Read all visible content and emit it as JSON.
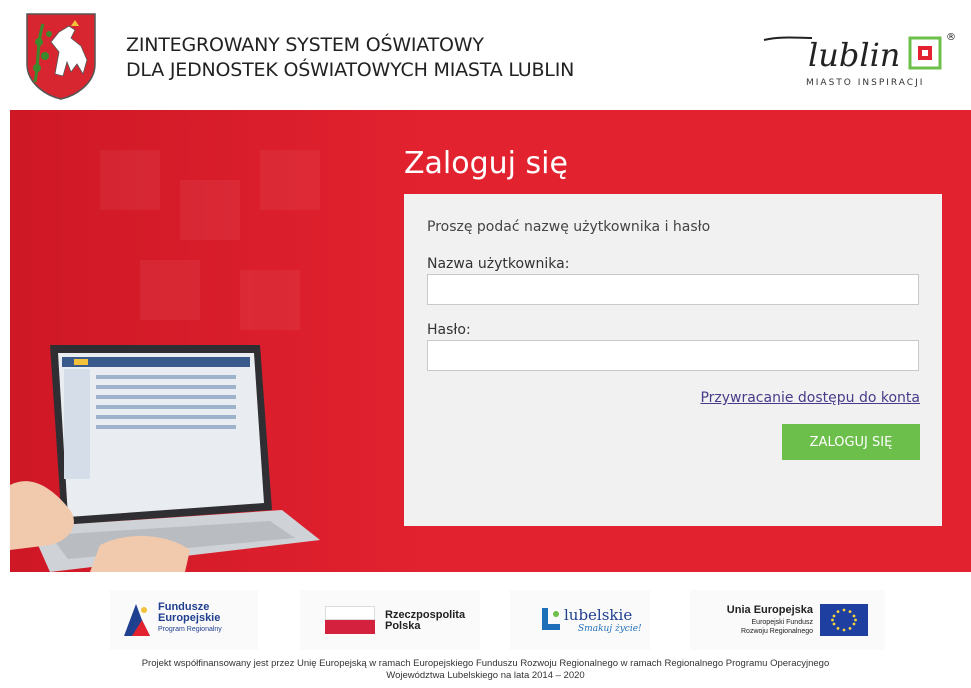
{
  "header": {
    "title_line1": "ZINTEGROWANY SYSTEM OŚWIATOWY",
    "title_line2": "DLA JEDNOSTEK OŚWIATOWYCH MIASTA LUBLIN",
    "lublin_logo_text": "lublin",
    "lublin_logo_sub": "MIASTO INSPIRACJI",
    "registered_mark": "®"
  },
  "login": {
    "title": "Zaloguj się",
    "instruction": "Proszę podać nazwę użytkownika i hasło",
    "username_label": "Nazwa użytkownika:",
    "username_value": "",
    "password_label": "Hasło:",
    "password_value": "",
    "recover_link": "Przywracanie dostępu do konta",
    "submit_label": "ZALOGUJ SIĘ"
  },
  "footer": {
    "logos": {
      "fe_line1": "Fundusze",
      "fe_line2": "Europejskie",
      "fe_line3": "Program Regionalny",
      "rp_line1": "Rzeczpospolita",
      "rp_line2": "Polska",
      "lub_line1": "lubelskie",
      "lub_line2": "Smakuj życie!",
      "ue_line1": "Unia Europejska",
      "ue_line2": "Europejski Fundusz",
      "ue_line3": "Rozwoju Regionalnego"
    },
    "note_line1": "Projekt współfinansowany jest przez Unię Europejską w ramach Europejskiego Funduszu Rozwoju Regionalnego w ramach Regionalnego Programu Operacyjnego",
    "note_line2": "Województwa Lubelskiego na lata 2014 – 2020"
  },
  "colors": {
    "hero_red": "#e2222f",
    "button_green": "#6bbf4a",
    "link_purple": "#4a3a8a"
  }
}
